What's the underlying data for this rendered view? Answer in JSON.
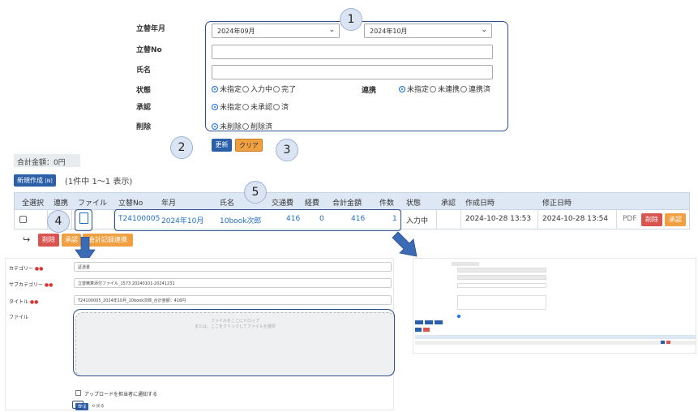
{
  "form": {
    "labels": {
      "month": "立替年月",
      "number": "立替No",
      "name": "氏名",
      "status": "状態",
      "link": "連携",
      "approval": "承認",
      "delete": "削除"
    },
    "month_from": "2024年09月",
    "month_to": "2024年10月",
    "status_options": [
      "未指定",
      "入力中",
      "完了"
    ],
    "link_options": [
      "未指定",
      "未連携",
      "連携済"
    ],
    "approval_options": [
      "未指定",
      "未承認",
      "済"
    ],
    "delete_options": [
      "未削除",
      "削除済"
    ],
    "update_button": "更新",
    "clear_button": "クリア"
  },
  "callouts": [
    "1",
    "2",
    "3",
    "4",
    "5"
  ],
  "total": "合計金額：0円",
  "new_button": "新規作成",
  "new_shortcut": "[N]",
  "count_text": "(1件中 1〜1 表示)",
  "table": {
    "headers": [
      "全選択",
      "連携",
      "ファイル",
      "立替No",
      "年月",
      "氏名",
      "交通費",
      "経費",
      "合計金額",
      "件数",
      "状態",
      "承認",
      "作成日時",
      "修正日時"
    ],
    "row": {
      "number": "T24100005",
      "month": "2024年10月",
      "name": "10book次郎",
      "transport": "416",
      "expense": "0",
      "total": "416",
      "count": "1",
      "status": "入力中",
      "created": "2024-10-28 13:53",
      "modified": "2024-10-28 13:54",
      "pdf": "PDF",
      "delete_btn": "削除",
      "approve_btn": "承認"
    },
    "bulk": {
      "delete": "削除",
      "approve": "承認",
      "accounting": "会計記録連携"
    }
  },
  "upload": {
    "category_label": "カテゴリー",
    "category_value": "証憑書",
    "subcategory_label": "サブカテゴリー",
    "subcategory_value": "立替精算添付ファイル_1573 20240101-20241231",
    "title_label": "タイトル",
    "title_value": "T24100005_2024年10月_10book次郎_合計金額：416円",
    "file_label": "ファイル",
    "drop_text": "ファイルをここにドロップ",
    "drop_sub": "または、ここをクリックしてファイルを選択",
    "notify_label": "アップロードを担当者に通知する",
    "register": "登録",
    "back": "戻る"
  },
  "colors": {
    "accent": "#2b5fa8",
    "orange": "#f0a040",
    "red": "#d9534f",
    "link": "#1f6fc5",
    "callout": "#2f4f8f"
  }
}
